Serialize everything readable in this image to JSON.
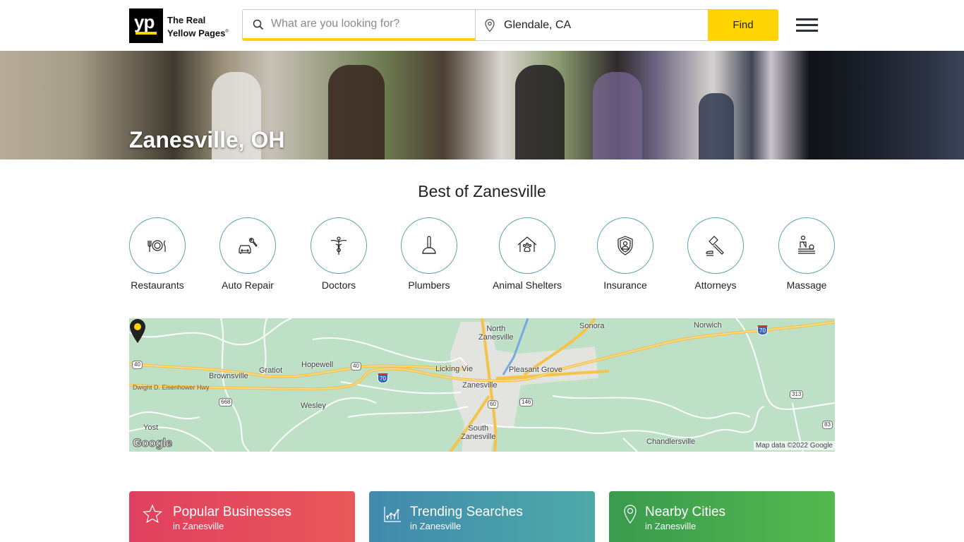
{
  "header": {
    "logo_mark": "yp",
    "logo_line1": "The Real",
    "logo_line2": "Yellow Pages",
    "logo_trademark": "®",
    "search_placeholder": "What are you looking for?",
    "search_value": "",
    "location_value": "Glendale, CA",
    "find_label": "Find",
    "accent_color": "#ffd400"
  },
  "hero": {
    "title": "Zanesville, OH"
  },
  "best_of": {
    "title": "Best of Zanesville",
    "categories": [
      {
        "label": "Restaurants",
        "icon": "fork-plate-knife-icon"
      },
      {
        "label": "Auto Repair",
        "icon": "car-wrench-icon"
      },
      {
        "label": "Doctors",
        "icon": "caduceus-icon"
      },
      {
        "label": "Plumbers",
        "icon": "plunger-icon"
      },
      {
        "label": "Animal Shelters",
        "icon": "paw-house-icon"
      },
      {
        "label": "Insurance",
        "icon": "shield-person-icon"
      },
      {
        "label": "Attorneys",
        "icon": "gavel-icon"
      },
      {
        "label": "Massage",
        "icon": "massage-icon"
      }
    ]
  },
  "map": {
    "places": [
      "North Zanesville",
      "Sonora",
      "Norwich",
      "Brownsville",
      "Gratiot",
      "Hopewell",
      "Licking View",
      "Pleasant Grove",
      "Zanesville",
      "Wesley",
      "Yost",
      "South Zanesville",
      "Chandlersville"
    ],
    "place_labels": {
      "north_zanesville_1": "North",
      "north_zanesville_2": "Zanesville",
      "sonora": "Sonora",
      "norwich": "Norwich",
      "brownsville": "Brownsville",
      "gratiot": "Gratiot",
      "hopewell": "Hopewell",
      "licking_view": "Licking Vie",
      "pleasant_grove": "Pleasant Grove",
      "zanesville": "Zanesville",
      "wesley": "Wesley",
      "yost": "Yost",
      "south_zanesville_1": "South",
      "south_zanesville_2": "Zanesville",
      "chandlersville": "Chandlersville"
    },
    "road_label": "Dwight D. Eisenhower Hwy",
    "shields": {
      "us40_west": "40",
      "us40_mid": "40",
      "i70_west": "70",
      "i70_east": "70",
      "sr668": "668",
      "sr60": "60",
      "sr146": "146",
      "sr313": "313",
      "sr83": "83"
    },
    "google_logo": "Google",
    "credit": "Map data ©2022 Google"
  },
  "cards": [
    {
      "title": "Popular Businesses",
      "subtitle": "in Zanesville",
      "icon": "star-icon",
      "color": "#e0405f"
    },
    {
      "title": "Trending Searches",
      "subtitle": "in Zanesville",
      "icon": "trend-chart-icon",
      "color": "#4189ad"
    },
    {
      "title": "Nearby Cities",
      "subtitle": "in Zanesville",
      "icon": "map-pin-icon",
      "color": "#3a9a4e"
    }
  ]
}
